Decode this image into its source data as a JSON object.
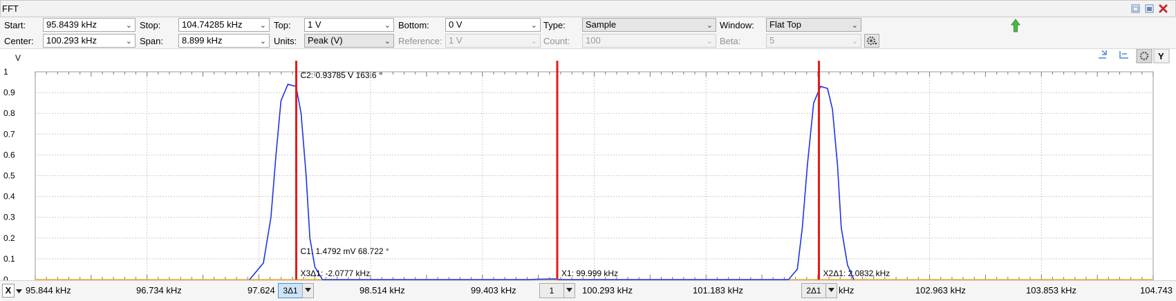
{
  "window": {
    "title": "FFT"
  },
  "controls": {
    "start_label": "Start:",
    "start_value": "95.8439 kHz",
    "stop_label": "Stop:",
    "stop_value": "104.74285 kHz",
    "top_label": "Top:",
    "top_value": "1 V",
    "bottom_label": "Bottom:",
    "bottom_value": "0 V",
    "type_label": "Type:",
    "type_value": "Sample",
    "window_label": "Window:",
    "window_value": "Flat Top",
    "center_label": "Center:",
    "center_value": "100.293 kHz",
    "span_label": "Span:",
    "span_value": "8.899 kHz",
    "units_label": "Units:",
    "units_value": "Peak (V)",
    "reference_label": "Reference:",
    "reference_value": "1 V",
    "count_label": "Count:",
    "count_value": "100",
    "beta_label": "Beta:",
    "beta_value": "5"
  },
  "y_axis": {
    "unit": "V",
    "ticks": [
      "1",
      "0.9",
      "0.8",
      "0.7",
      "0.6",
      "0.5",
      "0.4",
      "0.3",
      "0.2",
      "0.1",
      "0"
    ]
  },
  "cursors": {
    "c2": "C2: 0.93785 V   163.6 °",
    "c1": "C1: 1.4792 mV   68.722 °",
    "x3": "X3Δ1: -2.0777 kHz",
    "x1": "X1: 99.999 kHz",
    "x2": "X2Δ1: 2.0832 kHz"
  },
  "x_axis": {
    "axis_button": "X",
    "ticks": [
      "95.844 kHz",
      "96.734 kHz",
      "97.624",
      "98.514 kHz",
      "99.403 kHz",
      "100.293 kHz",
      "101.183 kHz",
      "kHz",
      "102.963 kHz",
      "103.853 kHz",
      "104.743"
    ],
    "selector_3": "3Δ1",
    "selector_1": "1",
    "selector_2": "2Δ1"
  },
  "colors": {
    "trace": "#1a33e6",
    "cursor": "#e11a1a",
    "grid": "#c9c9c9",
    "accent_arrow": "#3ab03a"
  },
  "chart_data": {
    "type": "line",
    "xlabel": "",
    "ylabel": "V",
    "xlim": [
      95.8439,
      104.74285
    ],
    "ylim": [
      0,
      1
    ],
    "series": [
      {
        "x": [
          97.55,
          97.66,
          97.72,
          97.76,
          97.8,
          97.855,
          97.92,
          97.96,
          98.0,
          98.03,
          98.07,
          98.13,
          99.77,
          99.85,
          99.98,
          100.02,
          101.84,
          101.91,
          101.95,
          101.99,
          102.04,
          102.095,
          102.15,
          102.19,
          102.23,
          102.26,
          102.31,
          102.36
        ],
        "y": [
          0.0,
          0.08,
          0.3,
          0.6,
          0.86,
          0.94,
          0.93,
          0.8,
          0.5,
          0.2,
          0.06,
          0.0,
          0.0,
          0.002,
          0.003,
          0.0,
          0.0,
          0.05,
          0.25,
          0.55,
          0.85,
          0.93,
          0.92,
          0.82,
          0.55,
          0.25,
          0.07,
          0.0
        ]
      }
    ],
    "markers_khz": {
      "x3": 97.9213,
      "x1": 99.999,
      "x2": 102.0822
    }
  }
}
